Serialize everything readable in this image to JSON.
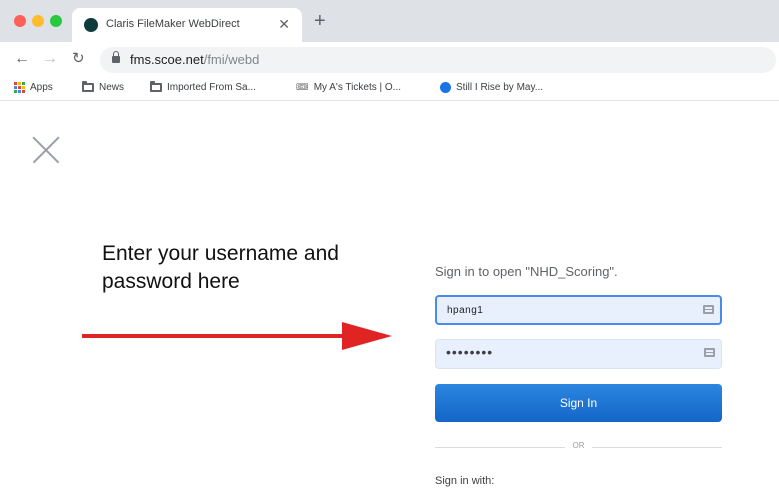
{
  "browser": {
    "tab_title": "Claris FileMaker WebDirect",
    "url_host": "fms.scoe.net",
    "url_path": "/fmi/webd"
  },
  "bookmarks": [
    {
      "label": "Apps",
      "icon": "apps-grid-icon"
    },
    {
      "label": "News",
      "icon": "folder-icon"
    },
    {
      "label": "Imported From Sa...",
      "icon": "folder-icon"
    },
    {
      "label": "My A's Tickets | O...",
      "icon": "ticket-icon"
    },
    {
      "label": "Still I Rise by May...",
      "icon": "globe-icon"
    }
  ],
  "annotation": {
    "text": "Enter your username and password here",
    "arrow_color": "#e02424"
  },
  "signin": {
    "title": "Sign in to open \"NHD_Scoring\".",
    "username_value": "hpang1",
    "password_mask": "••••••••",
    "button_label": "Sign In",
    "or_label": "OR",
    "sign_in_with": "Sign in with:"
  }
}
